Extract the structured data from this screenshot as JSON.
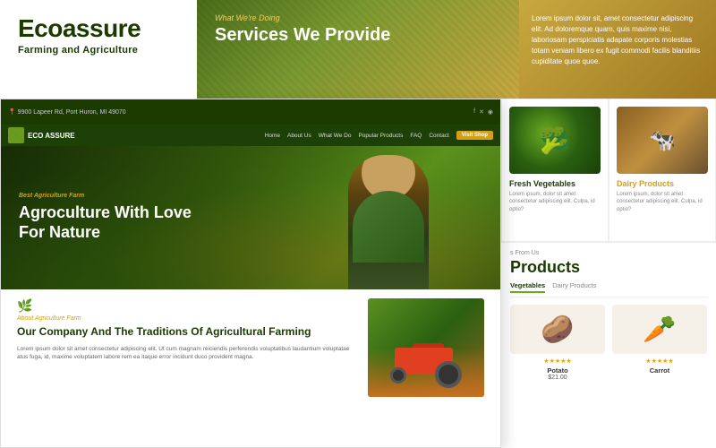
{
  "brand": {
    "name": "Ecoassure",
    "tagline": "Farming and Agriculture"
  },
  "services_banner": {
    "what_label": "What We're Doing",
    "title": "Services We Provide",
    "description": "Lorem ipsum dolor sit, amet consectetur adipiscing elit. Ad doloremque quam, quis maxime nisi, laboriosam perspiciatis adapate corporis molestias totam veniam libero ex fugit commodi facilis blanditiis cupiditate quoe quoe."
  },
  "mockup": {
    "address": "9900 Lapeer Rd, Port Huron, MI 49070",
    "logo": "ECO ASSURE",
    "nav": {
      "items": [
        "Home",
        "About Us",
        "What We Do",
        "Popular Products",
        "FAQ",
        "Contact"
      ],
      "cta": "Visit Shop"
    },
    "hero": {
      "small_label": "Best Agriculture Farm",
      "title": "Agroculture With Love For Nature"
    },
    "about": {
      "small_label": "About Agriculture Farm",
      "title": "Our Company And The Traditions Of Agricultural Farming",
      "text": "Lorem ipsum dolor sit amet consectetur adipiscing elit. Ut cum magnam reiciendis perferendis voluptatibus laudantium voluptatae atus fuga, id, maxime voluptatem labore rem ea itaque error incidunt duco provident magna."
    }
  },
  "right_panel": {
    "vegetables": {
      "title": "Fresh Vegetables",
      "desc": "Lorem ipsum, dolor sit amet consectetur adipiscing elit. Culpa, id optio?"
    },
    "dairy": {
      "title": "Dairy Products",
      "desc": "Lorem ipsum, dolor sit amet consectetur adipiscing elit. Culpa, id optio?"
    },
    "products_section": {
      "small_label": "s From Us",
      "title": "Products",
      "tabs": [
        "Vegetables",
        "Dairy Products"
      ],
      "items": [
        {
          "name": "Potato",
          "stars": "★★★★★",
          "price": "$21.00"
        },
        {
          "name": "Carrot",
          "stars": "★★★★★",
          "price": ""
        }
      ]
    }
  }
}
